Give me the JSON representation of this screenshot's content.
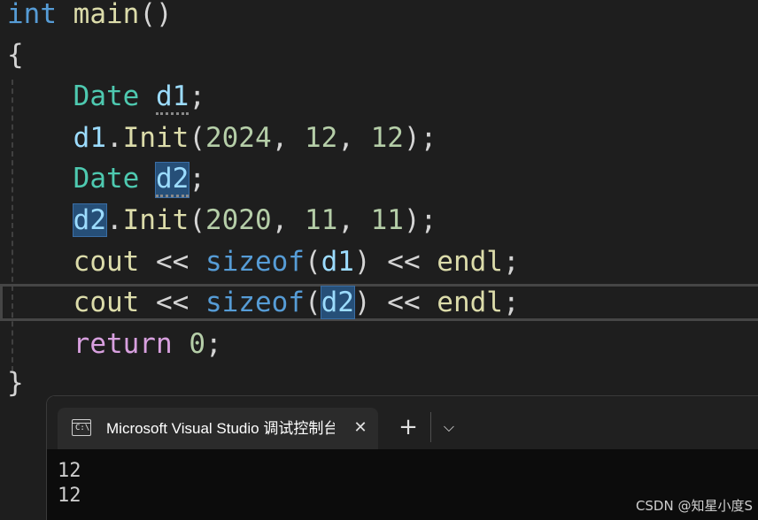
{
  "editor": {
    "lines": [
      {
        "tokens": [
          "int",
          " ",
          "main",
          "()"
        ]
      },
      {
        "tokens": [
          "{"
        ]
      },
      {
        "tokens": [
          "    ",
          "Date",
          " ",
          "d1",
          ";"
        ]
      },
      {
        "tokens": [
          "    ",
          "d1",
          ".",
          "Init",
          "(",
          "2024",
          ", ",
          "12",
          ", ",
          "12",
          ");"
        ]
      },
      {
        "tokens": [
          "    ",
          "Date",
          " ",
          "d2",
          ";"
        ]
      },
      {
        "tokens": [
          "    ",
          "d2",
          ".",
          "Init",
          "(",
          "2020",
          ", ",
          "11",
          ", ",
          "11",
          ");"
        ]
      },
      {
        "tokens": [
          "    ",
          "cout",
          " << ",
          "sizeof",
          "(",
          "d1",
          ") << ",
          "endl",
          ";"
        ]
      },
      {
        "tokens": [
          "    ",
          "cout",
          " << ",
          "sizeof",
          "(",
          "d2",
          ") << ",
          "endl",
          ";"
        ]
      },
      {
        "tokens": [
          "    ",
          "return",
          " ",
          "0",
          ";"
        ]
      },
      {
        "tokens": [
          "}"
        ]
      }
    ]
  },
  "terminal": {
    "tab_title": "Microsoft Visual Studio 调试控制台",
    "icon_text": "C:\\",
    "close_glyph": "✕",
    "new_tab_glyph": "+",
    "dropdown_glyph": "⌵",
    "output": [
      "12",
      "12"
    ]
  },
  "watermark": "CSDN @知星小度S"
}
